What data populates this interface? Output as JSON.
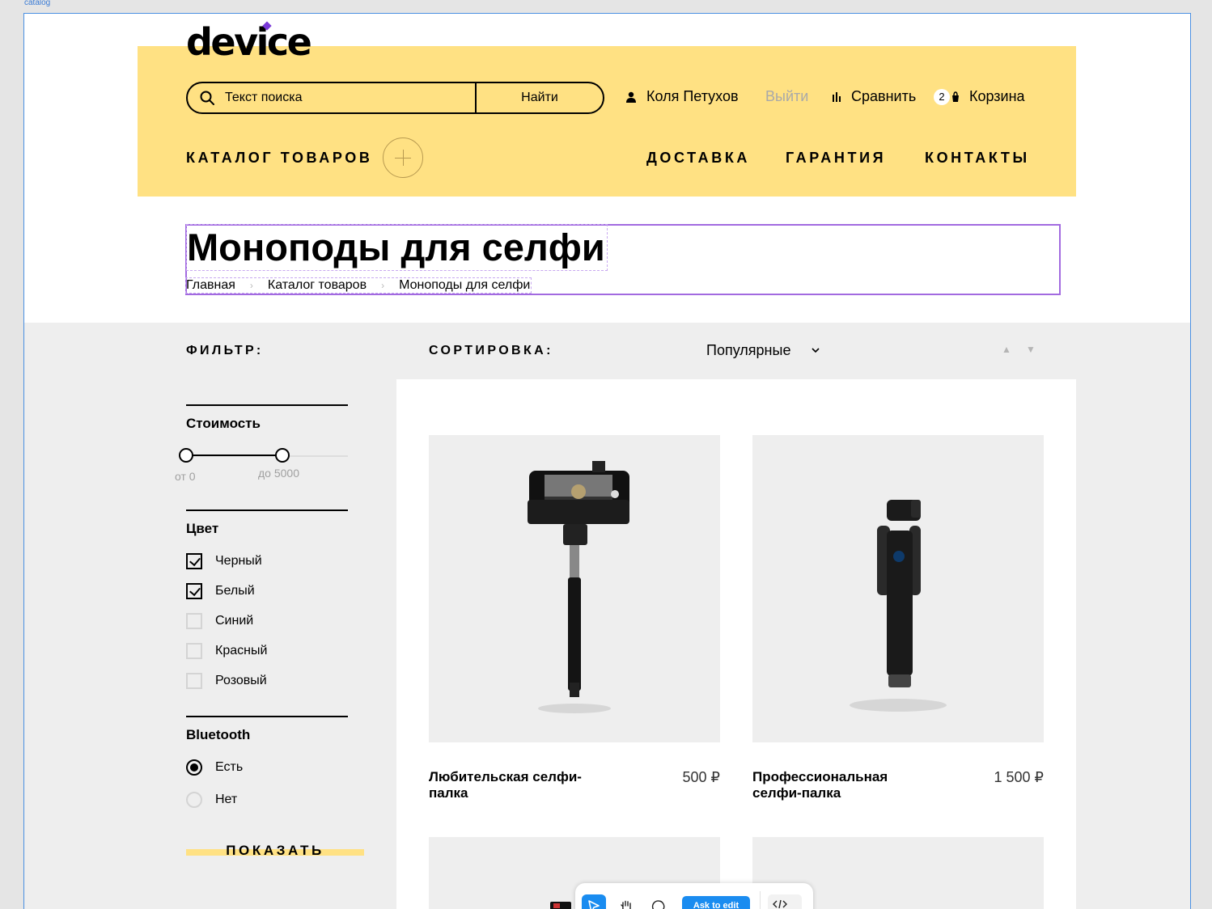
{
  "frame_label": "catalog",
  "header": {
    "logo": "device",
    "search": {
      "placeholder": "Текст поиска",
      "button": "Найти"
    },
    "user": {
      "name": "Коля Петухов",
      "logout": "Выйти"
    },
    "compare": "Сравнить",
    "cart": {
      "count": "2",
      "label": "Корзина"
    },
    "nav": {
      "catalog": "КАТАЛОГ ТОВАРОВ",
      "delivery": "ДОСТАВКА",
      "warranty": "ГАРАНТИЯ",
      "contacts": "КОНТАКТЫ"
    }
  },
  "page": {
    "title": "Моноподы для селфи",
    "breadcrumbs": [
      "Главная",
      "Каталог товаров",
      "Моноподы для селфи"
    ]
  },
  "filter": {
    "label": "ФИЛЬТР:",
    "price": {
      "title": "Стоимость",
      "from": "от 0",
      "to": "до 5000"
    },
    "color": {
      "title": "Цвет",
      "options": [
        {
          "label": "Черный",
          "checked": true
        },
        {
          "label": "Белый",
          "checked": true
        },
        {
          "label": "Синий",
          "checked": false
        },
        {
          "label": "Красный",
          "checked": false
        },
        {
          "label": "Розовый",
          "checked": false
        }
      ]
    },
    "bluetooth": {
      "title": "Bluetooth",
      "options": [
        {
          "label": "Есть",
          "selected": true
        },
        {
          "label": "Нет",
          "selected": false
        }
      ]
    },
    "show_button": "ПОКАЗАТЬ"
  },
  "sorting": {
    "label": "СОРТИРОВКА:",
    "value": "Популярные",
    "up": "▲",
    "down": "▼"
  },
  "products": [
    {
      "name": "Любительская селфи-палка",
      "price": "500 ₽"
    },
    {
      "name": "Профессиональная селфи-палка",
      "price": "1 500 ₽"
    }
  ],
  "toolbar": {
    "ask_edit": "Ask to edit"
  }
}
